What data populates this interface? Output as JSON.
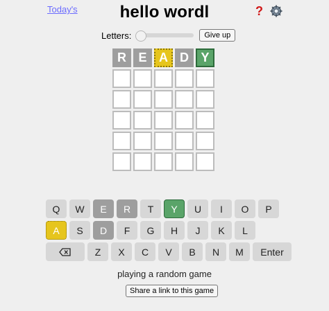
{
  "header": {
    "today_link": "Today's",
    "title": "hello wordl",
    "help_icon": "?",
    "help_icon_name": "help-icon",
    "settings_icon_name": "gear-icon"
  },
  "controls": {
    "letters_label": "Letters:",
    "slider_value_fraction": 0.0,
    "give_up_label": "Give up"
  },
  "board": {
    "rows": [
      [
        {
          "letter": "R",
          "state": "absent"
        },
        {
          "letter": "E",
          "state": "absent"
        },
        {
          "letter": "A",
          "state": "present"
        },
        {
          "letter": "D",
          "state": "absent"
        },
        {
          "letter": "Y",
          "state": "correct"
        }
      ],
      [
        {
          "letter": "",
          "state": "empty"
        },
        {
          "letter": "",
          "state": "empty"
        },
        {
          "letter": "",
          "state": "empty"
        },
        {
          "letter": "",
          "state": "empty"
        },
        {
          "letter": "",
          "state": "empty"
        }
      ],
      [
        {
          "letter": "",
          "state": "empty"
        },
        {
          "letter": "",
          "state": "empty"
        },
        {
          "letter": "",
          "state": "empty"
        },
        {
          "letter": "",
          "state": "empty"
        },
        {
          "letter": "",
          "state": "empty"
        }
      ],
      [
        {
          "letter": "",
          "state": "empty"
        },
        {
          "letter": "",
          "state": "empty"
        },
        {
          "letter": "",
          "state": "empty"
        },
        {
          "letter": "",
          "state": "empty"
        },
        {
          "letter": "",
          "state": "empty"
        }
      ],
      [
        {
          "letter": "",
          "state": "empty"
        },
        {
          "letter": "",
          "state": "empty"
        },
        {
          "letter": "",
          "state": "empty"
        },
        {
          "letter": "",
          "state": "empty"
        },
        {
          "letter": "",
          "state": "empty"
        }
      ],
      [
        {
          "letter": "",
          "state": "empty"
        },
        {
          "letter": "",
          "state": "empty"
        },
        {
          "letter": "",
          "state": "empty"
        },
        {
          "letter": "",
          "state": "empty"
        },
        {
          "letter": "",
          "state": "empty"
        }
      ]
    ]
  },
  "keyboard": {
    "rows": [
      [
        {
          "label": "Q",
          "state": "unused"
        },
        {
          "label": "W",
          "state": "unused"
        },
        {
          "label": "E",
          "state": "absent"
        },
        {
          "label": "R",
          "state": "absent"
        },
        {
          "label": "T",
          "state": "unused"
        },
        {
          "label": "Y",
          "state": "correct"
        },
        {
          "label": "U",
          "state": "unused"
        },
        {
          "label": "I",
          "state": "unused"
        },
        {
          "label": "O",
          "state": "unused"
        },
        {
          "label": "P",
          "state": "unused"
        }
      ],
      [
        {
          "label": "A",
          "state": "present"
        },
        {
          "label": "S",
          "state": "unused"
        },
        {
          "label": "D",
          "state": "absent"
        },
        {
          "label": "F",
          "state": "unused"
        },
        {
          "label": "G",
          "state": "unused"
        },
        {
          "label": "H",
          "state": "unused"
        },
        {
          "label": "J",
          "state": "unused"
        },
        {
          "label": "K",
          "state": "unused"
        },
        {
          "label": "L",
          "state": "unused"
        }
      ],
      [
        {
          "label": "",
          "icon": "backspace-icon",
          "state": "unused",
          "wide": true
        },
        {
          "label": "Z",
          "state": "unused"
        },
        {
          "label": "X",
          "state": "unused"
        },
        {
          "label": "C",
          "state": "unused"
        },
        {
          "label": "V",
          "state": "unused"
        },
        {
          "label": "B",
          "state": "unused"
        },
        {
          "label": "N",
          "state": "unused"
        },
        {
          "label": "M",
          "state": "unused"
        },
        {
          "label": "Enter",
          "state": "unused",
          "wide": true
        }
      ]
    ]
  },
  "footer": {
    "status": "playing a random game",
    "share_label": "Share a link to this game"
  },
  "colors": {
    "absent": "#9e9e9e",
    "present": "#e6c51d",
    "correct": "#5aa469",
    "link": "#6b6bff",
    "help": "#d01818"
  }
}
